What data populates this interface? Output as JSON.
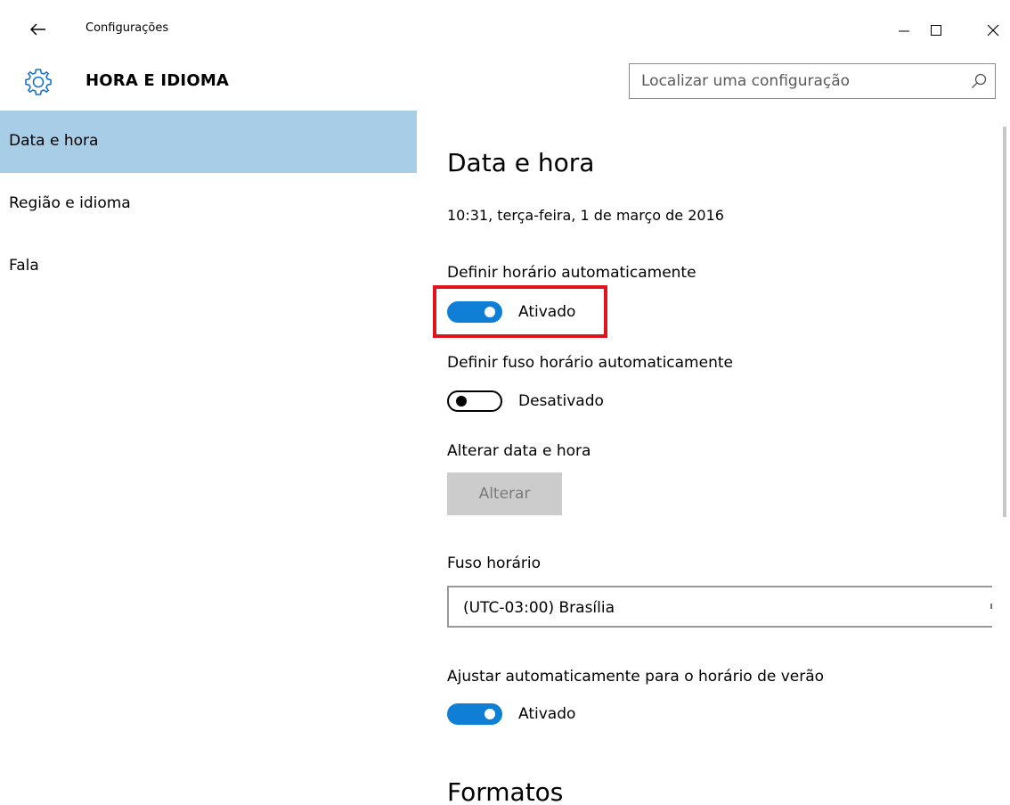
{
  "window": {
    "title": "Configurações",
    "minimize_glyph": "—",
    "maximize_glyph": "☐",
    "close_glyph": "✕"
  },
  "header": {
    "title": "HORA E IDIOMA",
    "icon": "gear-icon"
  },
  "search": {
    "placeholder": "Localizar uma configuração",
    "value": "",
    "icon": "search-icon"
  },
  "sidebar": {
    "items": [
      {
        "label": "Data e hora",
        "active": true
      },
      {
        "label": "Região e idioma",
        "active": false
      },
      {
        "label": "Fala",
        "active": false
      }
    ]
  },
  "main": {
    "title": "Data e hora",
    "current_datetime": "10:31, terça-feira, 1 de março de 2016",
    "auto_time": {
      "label": "Definir horário automaticamente",
      "state": "Ativado",
      "on": true
    },
    "auto_timezone": {
      "label": "Definir fuso horário automaticamente",
      "state": "Desativado",
      "on": false
    },
    "change_datetime": {
      "label": "Alterar data e hora",
      "button": "Alterar",
      "disabled": true
    },
    "timezone": {
      "label": "Fuso horário",
      "selected": "(UTC-03:00) Brasília"
    },
    "dst": {
      "label": "Ajustar automaticamente para o horário de verão",
      "state": "Ativado",
      "on": true
    },
    "formats_title": "Formatos"
  },
  "colors": {
    "accent": "#0f7fd6",
    "sidebar_active": "#a7cde7",
    "highlight_border": "#e0141e",
    "disabled_button": "#cccccc"
  }
}
